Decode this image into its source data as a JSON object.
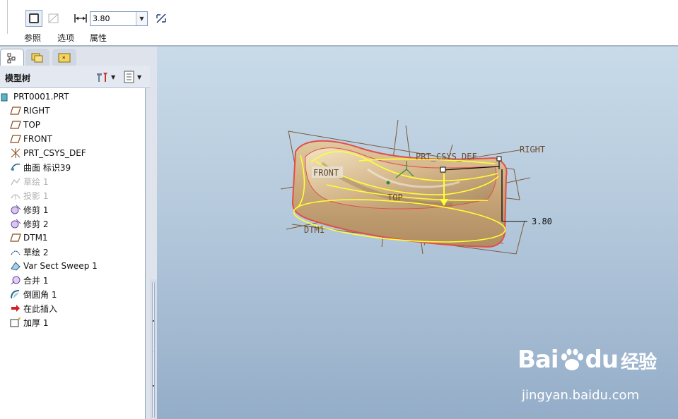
{
  "dashboard": {
    "thickness_label": "厚度",
    "thickness_value": "3.80",
    "tabs": [
      {
        "label": "参照"
      },
      {
        "label": "选项"
      },
      {
        "label": "属性"
      }
    ]
  },
  "navigator": {
    "title": "模型树",
    "items": [
      {
        "label": "PRT0001.PRT",
        "icon": "part-icon"
      },
      {
        "label": "RIGHT",
        "icon": "datum-plane-icon"
      },
      {
        "label": "TOP",
        "icon": "datum-plane-icon"
      },
      {
        "label": "FRONT",
        "icon": "datum-plane-icon"
      },
      {
        "label": "PRT_CSYS_DEF",
        "icon": "csys-icon"
      },
      {
        "label": "曲面 标识39",
        "icon": "surface-icon"
      },
      {
        "label": "草绘 1",
        "icon": "sketch-icon",
        "dim": true
      },
      {
        "label": "投影 1",
        "icon": "projection-icon",
        "dim": true
      },
      {
        "label": "修剪 1",
        "icon": "trim-icon"
      },
      {
        "label": "修剪 2",
        "icon": "trim-icon"
      },
      {
        "label": "DTM1",
        "icon": "datum-plane-icon"
      },
      {
        "label": "草绘 2",
        "icon": "sketch-icon"
      },
      {
        "label": "Var Sect Sweep 1",
        "icon": "sweep-icon"
      },
      {
        "label": "合并 1",
        "icon": "merge-icon"
      },
      {
        "label": "倒圆角 1",
        "icon": "round-icon"
      },
      {
        "label": "在此插入",
        "icon": "insert-here-icon"
      },
      {
        "label": "加厚 1",
        "icon": "thicken-icon"
      }
    ]
  },
  "viewport": {
    "datum_labels": {
      "right": "RIGHT",
      "front": "FRONT",
      "top": "TOP",
      "csys": "PRT_CSYS_DEF",
      "dtm": "DTM1"
    },
    "dimension_value": "3.80"
  },
  "watermark": {
    "brand": "Bai",
    "brand_tail": "du",
    "brand_cn": "经验",
    "url": "jingyan.baidu.com"
  },
  "colors": {
    "viewport_top": "#c9dbe9",
    "viewport_bottom": "#94adc8",
    "surface_fill": "#c9a87c",
    "highlight_yellow": "#ffff33",
    "edge_red": "#e0504a",
    "datum_brown": "#7a5a3a"
  }
}
